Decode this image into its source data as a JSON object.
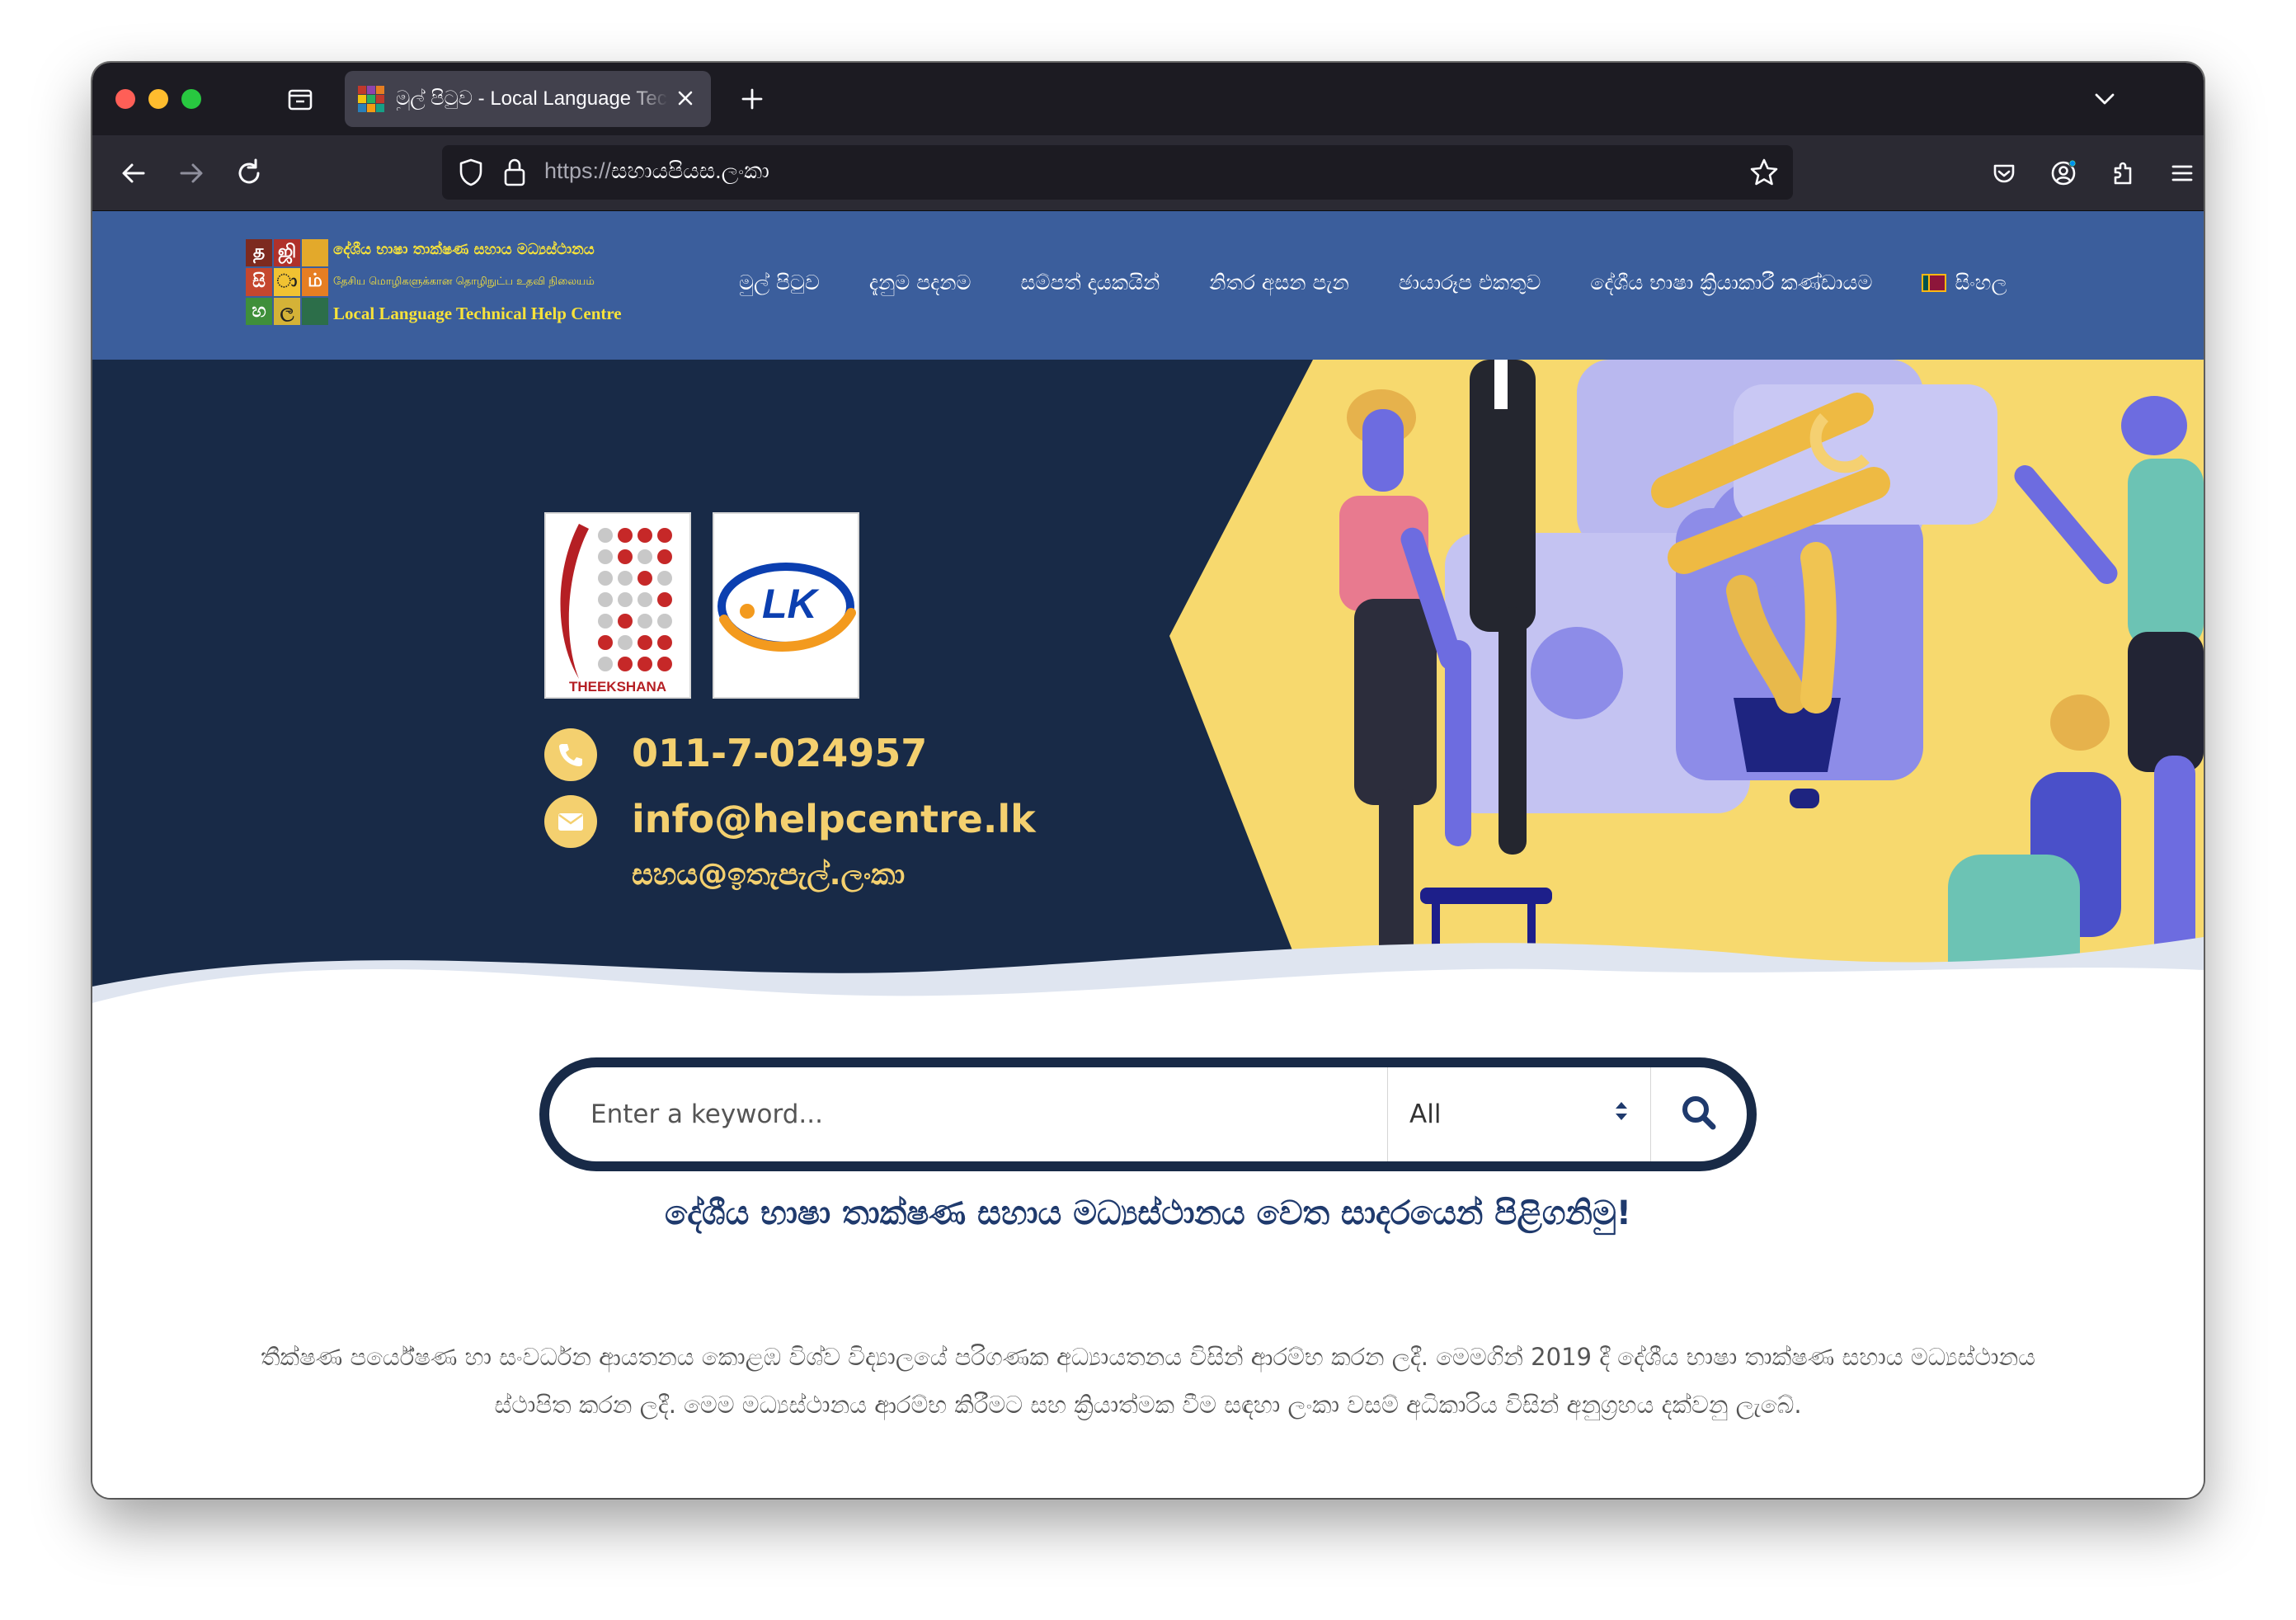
{
  "browser": {
    "tab_title": "මුල් පිටුව - Local Language Technical Help Centre",
    "url_scheme": "https://",
    "url_host": "සහායපියස.ලංකා"
  },
  "site": {
    "logo": {
      "glyphs": [
        "த",
        "ஜி",
        "සි",
        "ා",
        "ம்",
        "හ",
        "ල",
        " "
      ],
      "line1": "දේශීය භාෂා තාක්ෂණ සහාය මධ්‍යස්ථානය",
      "line2": "தேசிய மொழிகளுக்கான தொழிநுட்ப உதவி நிலையம்",
      "line3": "Local Language Technical Help Centre"
    },
    "nav": [
      "මුල් පිටුව",
      "දැනුම පදනම",
      "සම්පත් දායකයින්",
      "නිතර අසන පැන",
      "ඡායාරූප එකතුව",
      "දේශීය භාෂා ක්‍රියාකාරී කණ්ඩායම",
      "සිංහල"
    ]
  },
  "hero": {
    "partner1_text": "THEEKSHANA",
    "partner2_text": "LK",
    "phone": "011-7-024957",
    "email": "info@helpcentre.lk",
    "email_si": "සහය@ඉතැපැල්.ලංකා"
  },
  "search": {
    "placeholder": "Enter a keyword...",
    "category": "All"
  },
  "content": {
    "welcome": "දේශීය භාෂා තාක්ෂණ සහාය මධ්‍යස්ථානය වෙත සාදරයෙන් පිළිගනිමු!",
    "about_line1": "තීක්ෂණ පර්යේෂණ හා සංවර්ධන ආයතනය කොළඹ විශ්ව විද්‍යාලයේ පරිගණක  අධ්‍යායතනය විසින් ආරම්භ කරන ලදී. මෙමගින් 2019 දී දේශීය භාෂා තාක්ෂණ සහාය මධ්‍යස්ථානය",
    "about_line2": "ස්ථාපිත කරන ලදී. මෙම මධ්‍යස්ථානය ආරම්භ කිරීමට සහ ක්‍රියාත්මක වීම සඳහා ලංකා වසම් අධිකාරිය විසින් අනුග්‍රහය දක්වනු ලැබේ."
  },
  "colors": {
    "header_blue": "#3b5e9c",
    "hero_navy": "#182a47",
    "accent_yellow": "#f4d06f",
    "welcome_blue": "#1f3a6d"
  }
}
